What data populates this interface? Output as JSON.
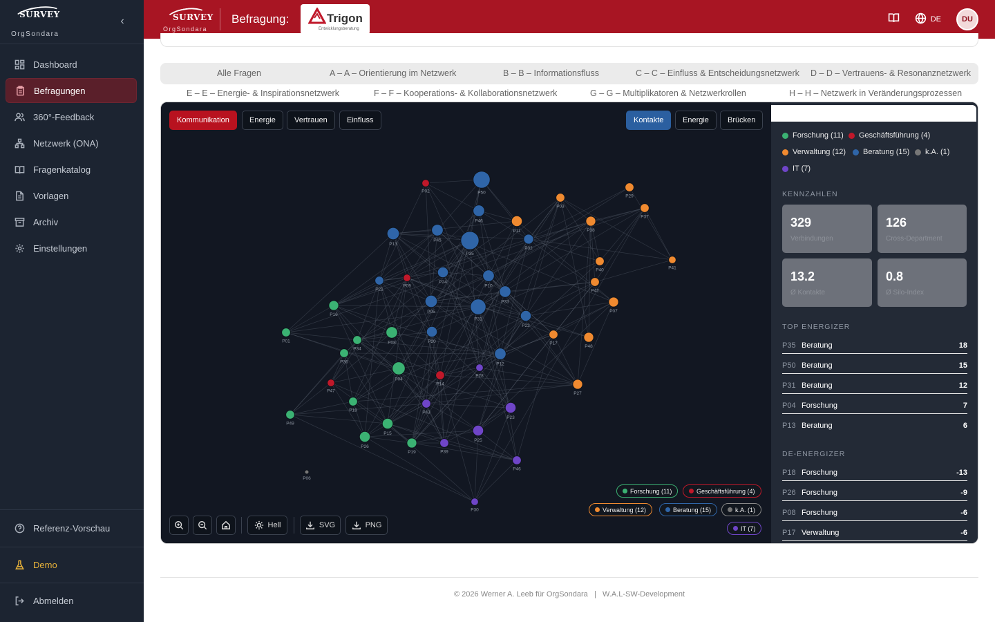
{
  "sidebar": {
    "brand": "SURVEY",
    "brand_sub": "OrgSondara",
    "items": [
      {
        "label": "Dashboard",
        "icon": "dashboard-icon"
      },
      {
        "label": "Befragungen",
        "icon": "clipboard-icon"
      },
      {
        "label": "360°-Feedback",
        "icon": "users-icon"
      },
      {
        "label": "Netzwerk (ONA)",
        "icon": "network-icon"
      },
      {
        "label": "Fragenkatalog",
        "icon": "book-icon"
      },
      {
        "label": "Vorlagen",
        "icon": "document-icon"
      },
      {
        "label": "Archiv",
        "icon": "archive-icon"
      },
      {
        "label": "Einstellungen",
        "icon": "gear-icon"
      }
    ],
    "bottom": [
      {
        "label": "Referenz-Vorschau",
        "icon": "help-icon"
      },
      {
        "label": "Demo",
        "icon": "flask-icon"
      },
      {
        "label": "Abmelden",
        "icon": "logout-icon"
      }
    ]
  },
  "topbar": {
    "brand": "SURVEY",
    "brand_sub": "OrgSondara",
    "label": "Befragung:",
    "partner": "Trigon",
    "partner_sub": "Entwicklungsberatung",
    "lang": "DE",
    "avatar": "DU"
  },
  "tabs": [
    "Alle Fragen",
    "A – A – Orientierung im Netzwerk",
    "B – B – Informationsfluss",
    "C – C – Einfluss & Entscheidungsnetzwerk",
    "D – D – Vertrauens- & Resonanznetzwerk",
    "E – E – Energie- & Inspirationsnetzwerk",
    "F – F – Kooperations- & Kollaborationsnetzwerk",
    "G – G – Multiplikatoren & Netzwerkrollen",
    "H – H – Netzwerk in Veränderungsprozessen"
  ],
  "graph": {
    "net_buttons": [
      "Kommunikation",
      "Energie",
      "Vertrauen",
      "Einfluss"
    ],
    "view_buttons": [
      "Kontakte",
      "Energie",
      "Brücken"
    ],
    "toolbar": {
      "theme": "Hell",
      "svg": "SVG",
      "png": "PNG"
    },
    "colors": {
      "Forschung": "#3bb273",
      "Geschäftsführung": "#c0182a",
      "Verwaltung": "#f08a30",
      "Beratung": "#2f65a8",
      "k.A.": "#777777",
      "IT": "#6f45c8"
    },
    "chips": [
      "Forschung (11)",
      "Geschäftsführung (4)",
      "Verwaltung (12)",
      "Beratung (15)",
      "k.A. (1)",
      "IT (7)"
    ],
    "nodes": [
      {
        "id": "P02",
        "g": "Geschäftsführung",
        "v": 1
      },
      {
        "id": "P50",
        "g": "Beratung",
        "v": 15
      },
      {
        "id": "P03",
        "g": "Verwaltung",
        "v": 2
      },
      {
        "id": "P29",
        "g": "Verwaltung",
        "v": 2
      },
      {
        "id": "P37",
        "g": "Verwaltung",
        "v": 2
      },
      {
        "id": "P46",
        "g": "Beratung",
        "v": 5
      },
      {
        "id": "P11",
        "g": "Verwaltung",
        "v": 4
      },
      {
        "id": "P38",
        "g": "Verwaltung",
        "v": 3
      },
      {
        "id": "P13",
        "g": "Beratung",
        "v": 6
      },
      {
        "id": "P45",
        "g": "Beratung",
        "v": 5
      },
      {
        "id": "P35",
        "g": "Beratung",
        "v": 18
      },
      {
        "id": "P32",
        "g": "Beratung",
        "v": 3
      },
      {
        "id": "P40",
        "g": "Verwaltung",
        "v": 2
      },
      {
        "id": "P41",
        "g": "Verwaltung",
        "v": 1
      },
      {
        "id": "P21",
        "g": "Beratung",
        "v": 2
      },
      {
        "id": "P09",
        "g": "Geschäftsführung",
        "v": 1
      },
      {
        "id": "P24",
        "g": "Beratung",
        "v": 4
      },
      {
        "id": "P10",
        "g": "Beratung",
        "v": 5
      },
      {
        "id": "P42",
        "g": "Verwaltung",
        "v": 2
      },
      {
        "id": "P33",
        "g": "Beratung",
        "v": 5
      },
      {
        "id": "P16",
        "g": "Forschung",
        "v": 3
      },
      {
        "id": "P05",
        "g": "Beratung",
        "v": 6
      },
      {
        "id": "P31",
        "g": "Beratung",
        "v": 12
      },
      {
        "id": "P22",
        "g": "Beratung",
        "v": 4
      },
      {
        "id": "P07",
        "g": "Verwaltung",
        "v": 3
      },
      {
        "id": "P01",
        "g": "Forschung",
        "v": 2
      },
      {
        "id": "P08",
        "g": "Forschung",
        "v": 5
      },
      {
        "id": "P20",
        "g": "Beratung",
        "v": 4
      },
      {
        "id": "P17",
        "g": "Verwaltung",
        "v": 2
      },
      {
        "id": "P48",
        "g": "Verwaltung",
        "v": 3
      },
      {
        "id": "P34",
        "g": "Forschung",
        "v": 2
      },
      {
        "id": "P36",
        "g": "Forschung",
        "v": 2
      },
      {
        "id": "P04",
        "g": "Forschung",
        "v": 7
      },
      {
        "id": "P28",
        "g": "IT",
        "v": 1
      },
      {
        "id": "P12",
        "g": "Beratung",
        "v": 5
      },
      {
        "id": "P14",
        "g": "Geschäftsführung",
        "v": 2
      },
      {
        "id": "P47",
        "g": "Geschäftsführung",
        "v": 1
      },
      {
        "id": "P27",
        "g": "Verwaltung",
        "v": 3
      },
      {
        "id": "P18",
        "g": "Forschung",
        "v": 2
      },
      {
        "id": "P43",
        "g": "IT",
        "v": 2
      },
      {
        "id": "P23",
        "g": "IT",
        "v": 4
      },
      {
        "id": "P49",
        "g": "Forschung",
        "v": 2
      },
      {
        "id": "P15",
        "g": "Forschung",
        "v": 4
      },
      {
        "id": "P26",
        "g": "Forschung",
        "v": 4
      },
      {
        "id": "P19",
        "g": "Forschung",
        "v": 3
      },
      {
        "id": "P39",
        "g": "IT",
        "v": 2
      },
      {
        "id": "P25",
        "g": "IT",
        "v": 4
      },
      {
        "id": "P46b",
        "label": "P46",
        "g": "IT",
        "v": 2
      },
      {
        "id": "P06",
        "g": "k.A.",
        "v": 0
      },
      {
        "id": "P30",
        "g": "IT",
        "v": 1
      }
    ]
  },
  "legend": [
    "Forschung (11)",
    "Geschäftsführung (4)",
    "Verwaltung (12)",
    "Beratung (15)",
    "k.A. (1)",
    "IT (7)"
  ],
  "kpis_title": "KENNZAHLEN",
  "kpis": [
    {
      "value": "329",
      "label": "Verbindungen"
    },
    {
      "value": "126",
      "label": "Cross-Department"
    },
    {
      "value": "13.2",
      "label": "Ø Kontakte"
    },
    {
      "value": "0.8",
      "label": "Ø Silo-Index"
    }
  ],
  "top_title": "TOP ENERGIZER",
  "top": [
    {
      "id": "P35",
      "dep": "Beratung",
      "val": "18"
    },
    {
      "id": "P50",
      "dep": "Beratung",
      "val": "15"
    },
    {
      "id": "P31",
      "dep": "Beratung",
      "val": "12"
    },
    {
      "id": "P04",
      "dep": "Forschung",
      "val": "7"
    },
    {
      "id": "P13",
      "dep": "Beratung",
      "val": "6"
    }
  ],
  "de_title": "DE-ENERGIZER",
  "de": [
    {
      "id": "P18",
      "dep": "Forschung",
      "val": "-13"
    },
    {
      "id": "P26",
      "dep": "Forschung",
      "val": "-9"
    },
    {
      "id": "P08",
      "dep": "Forschung",
      "val": "-6"
    },
    {
      "id": "P17",
      "dep": "Verwaltung",
      "val": "-6"
    }
  ],
  "footer": "© 2026 Werner A. Leeb für OrgSondara   |   W.A.L-SW-Development"
}
